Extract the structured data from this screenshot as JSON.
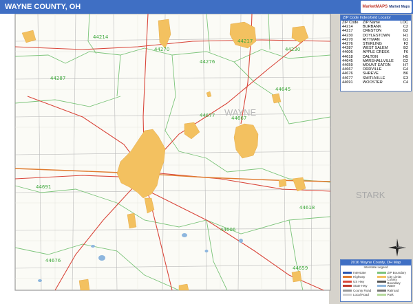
{
  "title": "WAYNE COUNTY, OH",
  "logo": {
    "text": "MarketMAPS",
    "sub": "Market Maps"
  },
  "county_label": "WAYNE",
  "neighbor_county_label": "STARK",
  "zip_panel": {
    "title": "ZIP Code Index/Grid Locator",
    "headers": [
      "ZIP Code",
      "ZIP Name",
      "LOC"
    ],
    "rows": [
      [
        "44214",
        "BURBANK",
        "C2"
      ],
      [
        "44217",
        "CRESTON",
        "G2"
      ],
      [
        "44230",
        "DOYLESTOWN",
        "H1"
      ],
      [
        "44270",
        "RITTMAN",
        "G1"
      ],
      [
        "44276",
        "STERLING",
        "F2"
      ],
      [
        "44287",
        "WEST SALEM",
        "B2"
      ],
      [
        "44606",
        "APPLE CREEK",
        "F6"
      ],
      [
        "44618",
        "DALTON",
        "H5"
      ],
      [
        "44645",
        "MARSHALLVILLE",
        "G2"
      ],
      [
        "44659",
        "MOUNT EATON",
        "H7"
      ],
      [
        "44667",
        "ORRVILLE",
        "G4"
      ],
      [
        "44676",
        "SHREVE",
        "B6"
      ],
      [
        "44677",
        "SMITHVILLE",
        "E3"
      ],
      [
        "44691",
        "WOOSTER",
        "C4"
      ]
    ]
  },
  "map_zip_labels": [
    {
      "id": "44214",
      "text": "44214"
    },
    {
      "id": "44217",
      "text": "44217"
    },
    {
      "id": "44270",
      "text": "44270"
    },
    {
      "id": "44230",
      "text": "44230"
    },
    {
      "id": "44287",
      "text": "44287"
    },
    {
      "id": "44276",
      "text": "44276"
    },
    {
      "id": "44645",
      "text": "44645"
    },
    {
      "id": "44677",
      "text": "44677"
    },
    {
      "id": "44667",
      "text": "44667"
    },
    {
      "id": "44691",
      "text": "44691"
    },
    {
      "id": "44618",
      "text": "44618"
    },
    {
      "id": "44606",
      "text": "44606"
    },
    {
      "id": "44676",
      "text": "44676"
    },
    {
      "id": "44659",
      "text": "44659"
    }
  ],
  "legend": {
    "title": "2016 Wayne County, OH Map",
    "subtitle": "Interstate Legend",
    "items_left": [
      "Interstate",
      "Highway",
      "US Hwy",
      "State Hwy",
      "County Road",
      "Local Road",
      "City Limits",
      "ZIP Boundary"
    ],
    "items_right": [
      "County Boundary",
      "Township",
      "Water",
      "Railroad",
      "Airport",
      "Park",
      "Scale Miles",
      "Grid"
    ]
  },
  "colors": {
    "title_bar": "#3f6fc4",
    "city_fill": "#f3c160",
    "zip_boundary": "#7cc47a",
    "road_red": "#d9463a",
    "water": "#8db6de",
    "outside_county": "#d6d3cc"
  }
}
